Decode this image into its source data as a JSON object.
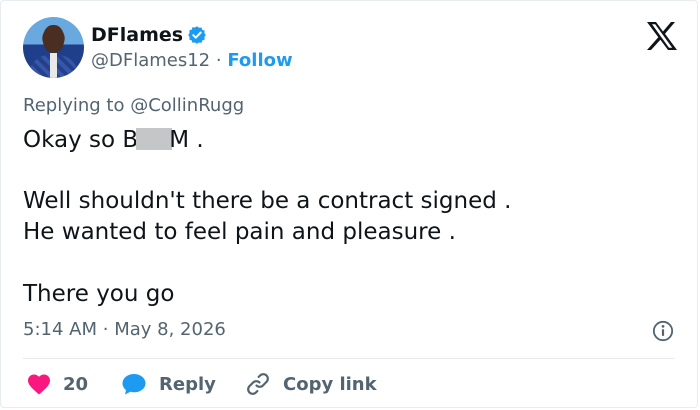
{
  "author": {
    "name": "DFlames",
    "handle": "@DFlames12",
    "separator": "·",
    "follow_label": "Follow",
    "verified": true
  },
  "reply_context": {
    "prefix": "Replying to",
    "mention": "@CollinRugg"
  },
  "tweet": {
    "line1_start": "Okay so B",
    "line1_end": "M .",
    "line2": "Well shouldn't there be a contract signed .",
    "line3": "He wanted to feel pain and pleasure .",
    "line4": "There you go"
  },
  "timestamp": {
    "time": "5:14 AM",
    "separator": "·",
    "date": "May 8, 2026"
  },
  "actions": {
    "like_count": "20",
    "reply_label": "Reply",
    "copy_label": "Copy link"
  },
  "colors": {
    "accent": "#1d9bf0",
    "like": "#f91880",
    "muted": "#536471",
    "text": "#0f1419"
  },
  "icons": [
    "verified-badge-icon",
    "x-logo-icon",
    "info-icon",
    "heart-icon",
    "reply-bubble-icon",
    "link-icon"
  ]
}
